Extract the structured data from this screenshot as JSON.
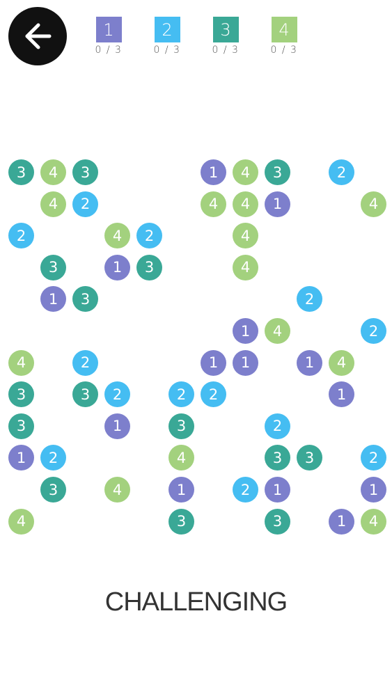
{
  "header": {
    "back_icon": "arrow-left-icon",
    "legend": [
      {
        "number": "1",
        "count": "0 / 3",
        "color": "#7d7fcc"
      },
      {
        "number": "2",
        "count": "0 / 3",
        "color": "#45bdf2"
      },
      {
        "number": "3",
        "count": "0 / 3",
        "color": "#3aa896"
      },
      {
        "number": "4",
        "count": "0 / 3",
        "color": "#a3d17e"
      }
    ]
  },
  "board": {
    "columns": 12,
    "rows": 12,
    "cells": [
      [
        3,
        4,
        3,
        0,
        0,
        0,
        1,
        4,
        3,
        0,
        2,
        0
      ],
      [
        0,
        4,
        2,
        0,
        0,
        0,
        4,
        4,
        1,
        0,
        0,
        4
      ],
      [
        2,
        0,
        0,
        4,
        2,
        0,
        0,
        4,
        0,
        0,
        0,
        0
      ],
      [
        0,
        3,
        0,
        1,
        3,
        0,
        0,
        4,
        0,
        0,
        0,
        0
      ],
      [
        0,
        1,
        3,
        0,
        0,
        0,
        0,
        0,
        0,
        2,
        0,
        0
      ],
      [
        0,
        0,
        0,
        0,
        0,
        0,
        0,
        1,
        4,
        0,
        0,
        2
      ],
      [
        4,
        0,
        2,
        0,
        0,
        0,
        1,
        1,
        0,
        1,
        4,
        0
      ],
      [
        3,
        0,
        3,
        2,
        0,
        2,
        2,
        0,
        0,
        0,
        1,
        0
      ],
      [
        3,
        0,
        0,
        1,
        0,
        3,
        0,
        0,
        2,
        0,
        0,
        0
      ],
      [
        1,
        2,
        0,
        0,
        0,
        4,
        0,
        0,
        3,
        3,
        0,
        2
      ],
      [
        0,
        3,
        0,
        4,
        0,
        1,
        0,
        2,
        1,
        0,
        0,
        1
      ],
      [
        4,
        0,
        0,
        0,
        0,
        3,
        0,
        0,
        3,
        0,
        1,
        4
      ]
    ]
  },
  "footer": {
    "difficulty_label": "CHALLENGING"
  }
}
